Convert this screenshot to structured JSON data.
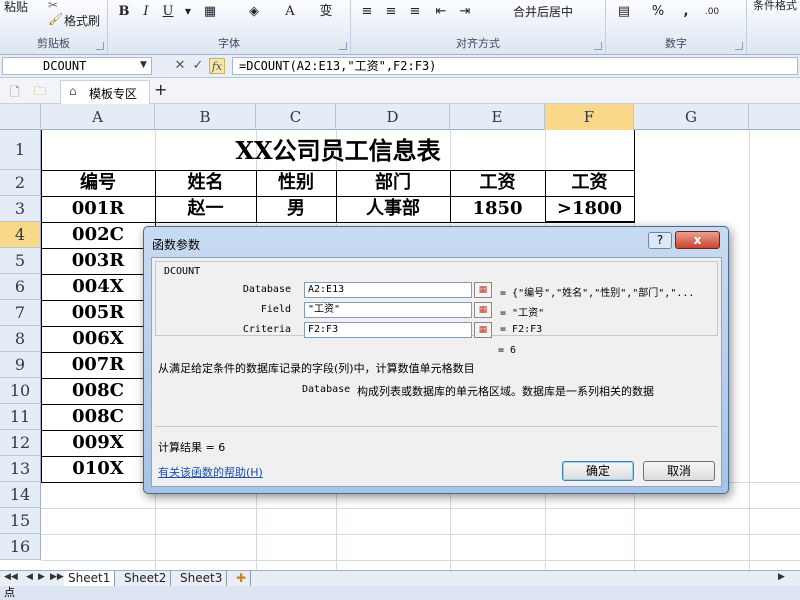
{
  "ribbon": {
    "paste_label": "粘贴",
    "format_painter_label": "格式刷",
    "clipboard_group": "剪贴板",
    "font_group": "字体",
    "alignment_group": "对齐方式",
    "number_group": "数字",
    "styles_partial": "条件格式",
    "merge_center_label": "合并后居中",
    "bold": "B",
    "italic": "I",
    "underline": "U",
    "percent": "%",
    "comma": ","
  },
  "formula_bar": {
    "name_box": "DCOUNT",
    "cancel": "✕",
    "enter": "✓",
    "fx": "fx",
    "formula": "=DCOUNT(A2:E13,\"工资\",F2:F3)"
  },
  "file_tabs": {
    "template_tab": "模板专区",
    "add": "+"
  },
  "columns": [
    "A",
    "B",
    "C",
    "D",
    "E",
    "F",
    "G"
  ],
  "rows": [
    "1",
    "2",
    "3",
    "4",
    "5",
    "6",
    "7",
    "8",
    "9",
    "10",
    "11",
    "12",
    "13",
    "14",
    "15",
    "16"
  ],
  "sheet": {
    "title": "XX公司员工信息表",
    "headers": [
      "编号",
      "姓名",
      "性别",
      "部门",
      "工资",
      "工资"
    ],
    "row3": [
      "001R",
      "赵一",
      "男",
      "人事部",
      "1850",
      ">1800"
    ],
    "ids": [
      "002C",
      "003R",
      "004X",
      "005R",
      "006X",
      "007R",
      "008C",
      "008C",
      "009X",
      "010X"
    ]
  },
  "sheet_tabs": [
    "Sheet1",
    "Sheet2",
    "Sheet3"
  ],
  "status": {
    "mode": "点"
  },
  "dialog": {
    "title": "函数参数",
    "help_button": "?",
    "close_button": "x",
    "function_name": "DCOUNT",
    "args": [
      {
        "label": "Database",
        "value": "A2:E13",
        "result": "{\"编号\",\"姓名\",\"性别\",\"部门\",\"..."
      },
      {
        "label": "Field",
        "value": "\"工资\"",
        "result": "\"工资\""
      },
      {
        "label": "Criteria",
        "value": "F2:F3",
        "result": "F2:F3"
      }
    ],
    "function_result": "= 6",
    "description": "从满足给定条件的数据库记录的字段(列)中，计算数值单元格数目",
    "arg_description_name": "Database",
    "arg_description": "构成列表或数据库的单元格区域。数据库是一系列相关的数据",
    "calc_result": "计算结果 = 6",
    "help_link": "有关该函数的帮助(H)",
    "ok": "确定",
    "cancel": "取消"
  },
  "colors": {
    "selected_header": "#f9d88a",
    "dialog_frame": "#a7c3e6",
    "close_red": "#c9452c"
  }
}
